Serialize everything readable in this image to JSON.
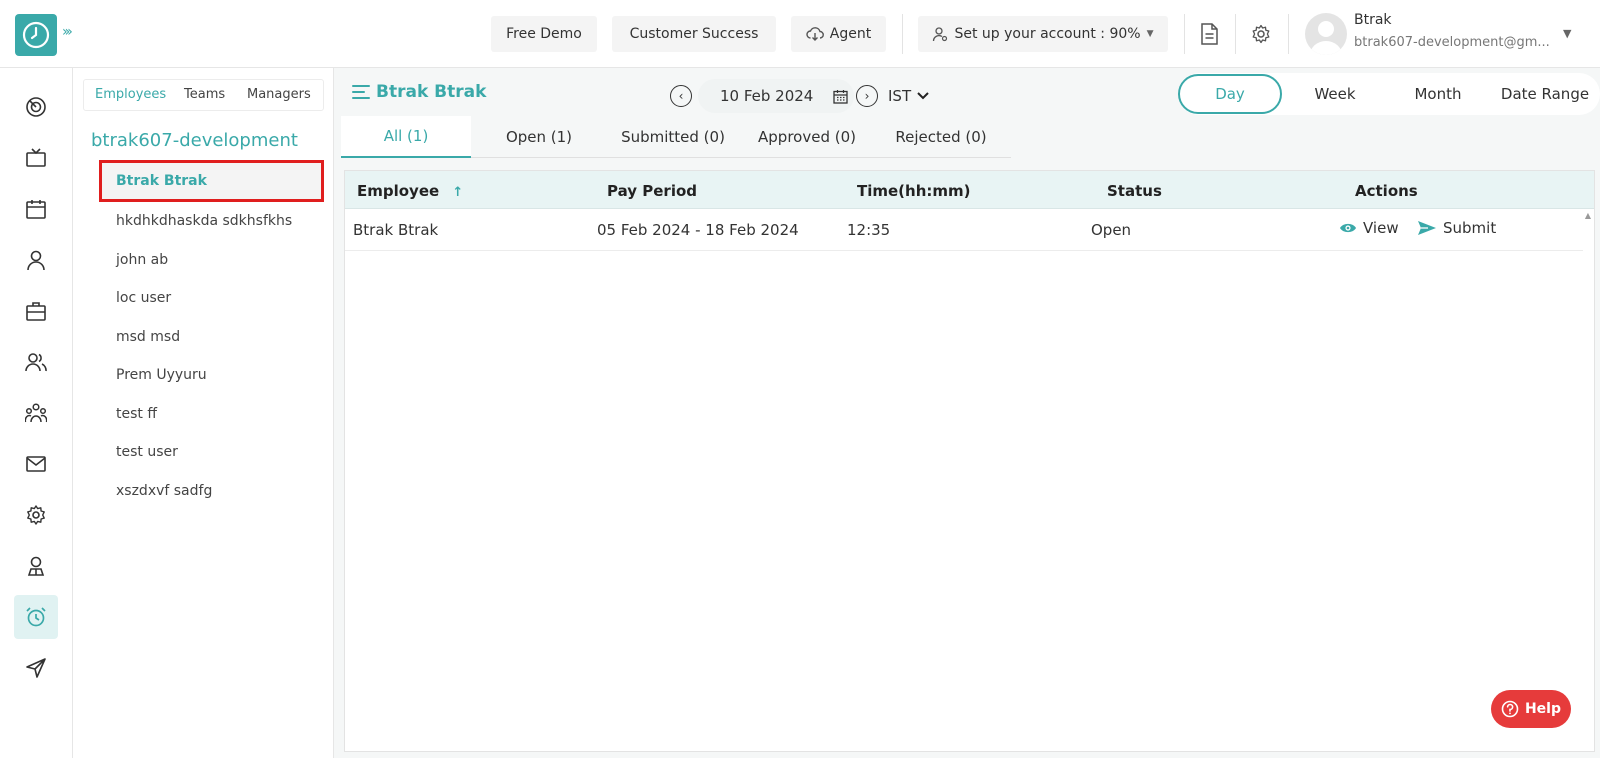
{
  "header": {
    "free_demo": "Free Demo",
    "customer_success": "Customer Success",
    "agent": "Agent",
    "setup": "Set up your account : 90%",
    "user_name": "Btrak",
    "user_email": "btrak607-development@gm..."
  },
  "employee_panel": {
    "tabs": [
      "Employees",
      "Teams",
      "Managers"
    ],
    "org_name": "btrak607-development",
    "employees": [
      "Btrak Btrak",
      "hkdhkdhaskda sdkhsfkhs",
      "john ab",
      "loc user",
      "msd msd",
      "Prem Uyyuru",
      "test ff",
      "test user",
      "xszdxvf sadfg"
    ]
  },
  "main": {
    "title": "Btrak Btrak",
    "date": "10 Feb 2024",
    "timezone": "IST",
    "range_tabs": [
      "Day",
      "Week",
      "Month",
      "Date Range"
    ],
    "status_tabs": [
      "All (1)",
      "Open (1)",
      "Submitted (0)",
      "Approved (0)",
      "Rejected (0)"
    ]
  },
  "table": {
    "headers": [
      "Employee",
      "Pay Period",
      "Time(hh:mm)",
      "Status",
      "Actions"
    ],
    "rows": [
      {
        "employee": "Btrak Btrak",
        "pay_period": "05 Feb 2024 - 18 Feb 2024",
        "time": "12:35",
        "status": "Open",
        "view_label": "View",
        "submit_label": "Submit"
      }
    ]
  },
  "help": "Help",
  "colors": {
    "accent": "#3aa9a9",
    "highlight": "#e01e1e",
    "help": "#e63b3b"
  }
}
